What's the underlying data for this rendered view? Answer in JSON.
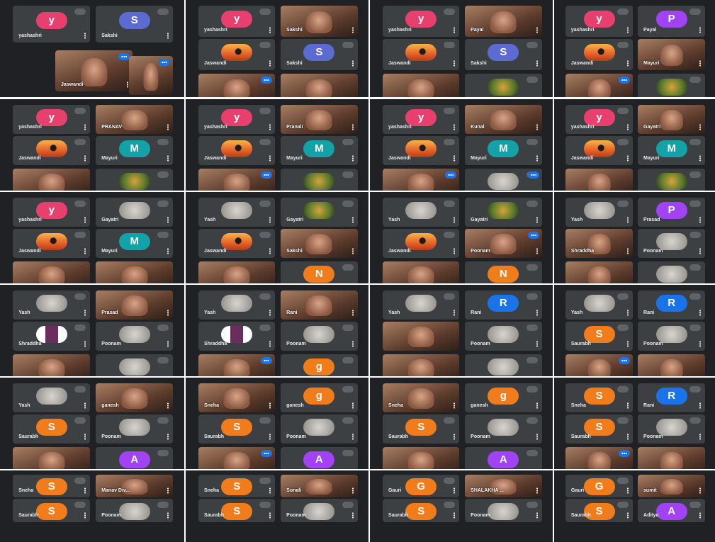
{
  "app": {
    "title": "Google Meet participant grid collage"
  },
  "colors": {
    "background": "#202124",
    "tile": "#3c4043",
    "speaking": "#1a73e8",
    "divider": "#ffffff"
  },
  "avatar_colors": {
    "y": "#e8406e",
    "S": "#f07c1c",
    "S-blue": "#5c6bd1",
    "M": "#12a2a8",
    "N": "#f07c1c",
    "R": "#1a73e8",
    "g": "#f07c1c",
    "G": "#f07c1c",
    "A": "#a142f4",
    "P": "#a142f4"
  },
  "panels": [
    {
      "tiles": [
        {
          "name": "yashashri",
          "avatar": "y"
        },
        {
          "name": "Sakshi",
          "avatar": "S",
          "avatar_color": "S-blue"
        },
        {
          "name": "Jaswandi",
          "video": true,
          "speaking": true
        },
        {
          "name": "",
          "video": true,
          "speaking": true
        }
      ]
    },
    {
      "tiles": [
        {
          "name": "yashashri",
          "avatar": "y"
        },
        {
          "name": "Sakshi",
          "video": true
        },
        {
          "name": "Jaswandi",
          "picture": "sunset"
        },
        {
          "name": "Sakshi",
          "avatar": "S",
          "avatar_color": "S-blue"
        },
        {
          "name": "",
          "video": true,
          "speaking": true
        },
        {
          "name": "",
          "video": true
        }
      ]
    },
    {
      "tiles": [
        {
          "name": "yashashri",
          "avatar": "y"
        },
        {
          "name": "Payal",
          "video": true
        },
        {
          "name": "Jaswandi",
          "picture": "sunset"
        },
        {
          "name": "Sakshi",
          "avatar": "S",
          "avatar_color": "S-blue"
        },
        {
          "name": "",
          "video": true
        },
        {
          "name": "",
          "picture": "flower"
        }
      ]
    },
    {
      "tiles": [
        {
          "name": "yashashri",
          "avatar": "y"
        },
        {
          "name": "Payal",
          "avatar": "P"
        },
        {
          "name": "Jaswandi",
          "picture": "sunset"
        },
        {
          "name": "Mayuri",
          "video": true
        },
        {
          "name": "",
          "video": true,
          "speaking": true
        },
        {
          "name": "",
          "picture": "flower"
        }
      ]
    },
    {
      "tiles": [
        {
          "name": "yashashri",
          "avatar": "y"
        },
        {
          "name": "PRANAV",
          "video": true
        },
        {
          "name": "Jaswandi",
          "picture": "sunset"
        },
        {
          "name": "Mayuri",
          "avatar": "M"
        },
        {
          "name": "",
          "video": true
        },
        {
          "name": "",
          "picture": "flower"
        }
      ]
    },
    {
      "tiles": [
        {
          "name": "yashashri",
          "avatar": "y"
        },
        {
          "name": "Pranali",
          "video": true
        },
        {
          "name": "Jaswandi",
          "picture": "sunset"
        },
        {
          "name": "Mayuri",
          "avatar": "M"
        },
        {
          "name": "",
          "video": true,
          "speaking": true
        },
        {
          "name": "",
          "picture": "flower"
        }
      ]
    },
    {
      "tiles": [
        {
          "name": "yashashri",
          "avatar": "y"
        },
        {
          "name": "Kunal",
          "video": true
        },
        {
          "name": "Jaswandi",
          "picture": "sunset"
        },
        {
          "name": "Mayuri",
          "avatar": "M"
        },
        {
          "name": "",
          "video": true,
          "speaking": true
        },
        {
          "name": "",
          "picture": "sketch",
          "speaking": true
        }
      ]
    },
    {
      "tiles": [
        {
          "name": "yashashri",
          "avatar": "y"
        },
        {
          "name": "Gayatri",
          "video": true
        },
        {
          "name": "Jaswandi",
          "picture": "sunset"
        },
        {
          "name": "Mayuri",
          "avatar": "M"
        },
        {
          "name": "",
          "video": true
        },
        {
          "name": "",
          "picture": "flower"
        }
      ]
    },
    {
      "tiles": [
        {
          "name": "yashashri",
          "avatar": "y"
        },
        {
          "name": "Gayatri",
          "picture": "sketch"
        },
        {
          "name": "Jaswandi",
          "picture": "sunset"
        },
        {
          "name": "Mayuri",
          "avatar": "M"
        },
        {
          "name": "",
          "video": true
        },
        {
          "name": "",
          "video": true
        }
      ]
    },
    {
      "tiles": [
        {
          "name": "Yash",
          "picture": "sketch"
        },
        {
          "name": "Gayatri",
          "picture": "flower"
        },
        {
          "name": "Jaswandi",
          "picture": "sunset"
        },
        {
          "name": "Sakshi",
          "video": true
        },
        {
          "name": "",
          "video": true
        },
        {
          "name": "",
          "avatar": "N"
        }
      ]
    },
    {
      "tiles": [
        {
          "name": "Yash",
          "picture": "sketch"
        },
        {
          "name": "Gayatri",
          "picture": "flower"
        },
        {
          "name": "Jaswandi",
          "picture": "sunset"
        },
        {
          "name": "Poonam",
          "video": true,
          "speaking": true
        },
        {
          "name": "",
          "video": true
        },
        {
          "name": "",
          "avatar": "N"
        }
      ]
    },
    {
      "tiles": [
        {
          "name": "Yash",
          "picture": "sketch"
        },
        {
          "name": "Prasad",
          "avatar": "P"
        },
        {
          "name": "Shraddha",
          "video": true
        },
        {
          "name": "Poonam",
          "picture": "sketch"
        },
        {
          "name": "",
          "video": true
        },
        {
          "name": "",
          "picture": "sketch"
        }
      ]
    },
    {
      "tiles": [
        {
          "name": "Yash",
          "picture": "sketch"
        },
        {
          "name": "Prasad",
          "video": true
        },
        {
          "name": "Shraddha",
          "picture": "person"
        },
        {
          "name": "Poonam",
          "picture": "sketch"
        },
        {
          "name": "",
          "video": true
        },
        {
          "name": "",
          "picture": "sketch"
        }
      ]
    },
    {
      "tiles": [
        {
          "name": "Yash",
          "picture": "sketch"
        },
        {
          "name": "Rani",
          "video": true
        },
        {
          "name": "Shraddha",
          "picture": "person"
        },
        {
          "name": "Poonam",
          "picture": "sketch"
        },
        {
          "name": "",
          "video": true,
          "speaking": true
        },
        {
          "name": "",
          "avatar": "g"
        }
      ]
    },
    {
      "tiles": [
        {
          "name": "Yash",
          "picture": "sketch"
        },
        {
          "name": "Rani",
          "avatar": "R"
        },
        {
          "name": "",
          "video": true
        },
        {
          "name": "Poonam",
          "picture": "sketch"
        },
        {
          "name": "",
          "video": true
        },
        {
          "name": "",
          "picture": "sketch"
        }
      ]
    },
    {
      "tiles": [
        {
          "name": "Yash",
          "picture": "sketch"
        },
        {
          "name": "Rani",
          "avatar": "R"
        },
        {
          "name": "Saurabh",
          "avatar": "S"
        },
        {
          "name": "Poonam",
          "picture": "sketch"
        },
        {
          "name": "",
          "video": true,
          "speaking": true
        },
        {
          "name": "",
          "video": true
        }
      ]
    },
    {
      "tiles": [
        {
          "name": "Yash",
          "picture": "sketch"
        },
        {
          "name": "ganesh",
          "video": true
        },
        {
          "name": "Saurabh",
          "avatar": "S"
        },
        {
          "name": "Poonam",
          "picture": "sketch"
        },
        {
          "name": "",
          "video": true
        },
        {
          "name": "",
          "avatar": "A"
        }
      ]
    },
    {
      "tiles": [
        {
          "name": "Sneha",
          "video": true
        },
        {
          "name": "ganesh",
          "avatar": "g"
        },
        {
          "name": "Saurabh",
          "avatar": "S"
        },
        {
          "name": "Poonam",
          "picture": "sketch"
        },
        {
          "name": "",
          "video": true,
          "speaking": true
        },
        {
          "name": "",
          "avatar": "A"
        }
      ]
    },
    {
      "tiles": [
        {
          "name": "Sneha",
          "video": true
        },
        {
          "name": "ganesh",
          "avatar": "g"
        },
        {
          "name": "Saurabh",
          "avatar": "S"
        },
        {
          "name": "Poonam",
          "picture": "sketch"
        },
        {
          "name": "",
          "video": true
        },
        {
          "name": "",
          "avatar": "A"
        }
      ]
    },
    {
      "tiles": [
        {
          "name": "Sneha",
          "avatar": "S"
        },
        {
          "name": "Rani",
          "avatar": "R"
        },
        {
          "name": "Saurabh",
          "avatar": "S"
        },
        {
          "name": "Poonam",
          "picture": "sketch"
        },
        {
          "name": "",
          "video": true,
          "speaking": true
        },
        {
          "name": "",
          "video": true
        }
      ]
    },
    {
      "tiles": [
        {
          "name": "Sneha",
          "avatar": "S"
        },
        {
          "name": "Manav Div...",
          "video": true
        },
        {
          "name": "Saurabh",
          "avatar": "S"
        },
        {
          "name": "Poonam",
          "picture": "sketch"
        }
      ]
    },
    {
      "tiles": [
        {
          "name": "Sneha",
          "avatar": "S"
        },
        {
          "name": "Sonali",
          "video": true
        },
        {
          "name": "Saurabh",
          "avatar": "S"
        },
        {
          "name": "Poonam",
          "picture": "sketch"
        }
      ]
    },
    {
      "tiles": [
        {
          "name": "Gauri",
          "avatar": "G"
        },
        {
          "name": "SHALAKHA ...",
          "video": true
        },
        {
          "name": "Saurabh",
          "avatar": "S"
        },
        {
          "name": "Poonam",
          "picture": "sketch"
        }
      ]
    },
    {
      "tiles": [
        {
          "name": "Gauri",
          "avatar": "G"
        },
        {
          "name": "sumit",
          "video": true
        },
        {
          "name": "Saurabh",
          "avatar": "S"
        },
        {
          "name": "Aditya",
          "avatar": "A"
        }
      ]
    }
  ]
}
